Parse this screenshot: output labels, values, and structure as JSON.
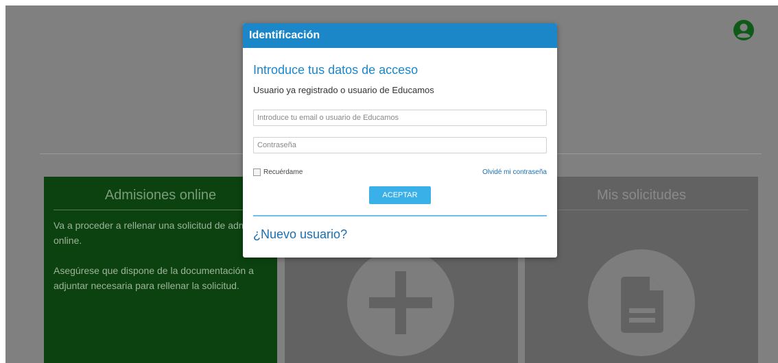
{
  "background": {
    "cards": [
      {
        "title": "Admisiones online",
        "paragraphs": [
          "Va a proceder a rellenar una solicitud de admisión online.",
          "Asegúrese que dispone de la documentación a adjuntar necesaria para rellenar la solicitud."
        ]
      },
      {
        "title": ""
      },
      {
        "title": "Mis solicitudes"
      }
    ]
  },
  "modal": {
    "header": "Identificación",
    "title": "Introduce tus datos de acceso",
    "subtitle": "Usuario ya registrado o usuario de Educamos",
    "user_placeholder": "Introduce tu email o usuario de Educamos",
    "password_placeholder": "Contraseña",
    "remember_label": "Recuérdame",
    "forgot_link": "Olvidé mi contraseña",
    "accept_button": "ACEPTAR",
    "new_user_link": "¿Nuevo usuario?"
  },
  "colors": {
    "accent": "#1b87c9",
    "button": "#3ab0e8",
    "green_card": "#0b420f",
    "user_icon": "#0e5a18"
  },
  "icons": [
    "user-circle-icon",
    "plus-icon",
    "document-icon"
  ]
}
